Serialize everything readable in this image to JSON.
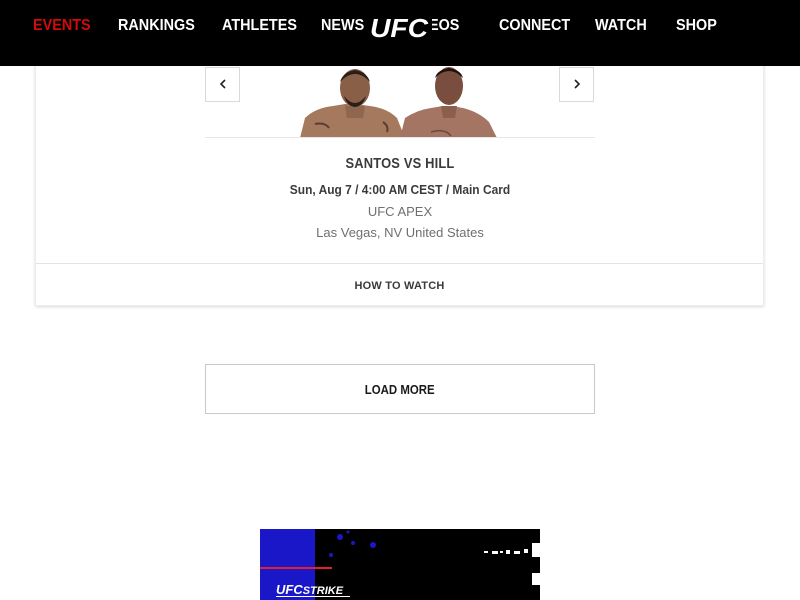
{
  "nav": {
    "items": [
      {
        "label": "EVENTS",
        "active": true
      },
      {
        "label": "RANKINGS",
        "active": false
      },
      {
        "label": "ATHLETES",
        "active": false
      },
      {
        "label": "NEWS",
        "active": false
      },
      {
        "label": "VIDEOS",
        "active": false
      },
      {
        "label": "CONNECT",
        "active": false
      },
      {
        "label": "WATCH",
        "active": false
      },
      {
        "label": "SHOP",
        "active": false
      }
    ],
    "logo_text": "UFC",
    "active_color": "#d20a0a"
  },
  "event": {
    "title": "SANTOS VS HILL",
    "datetime": "Sun, Aug 7 / 4:00 AM CEST / Main Card",
    "venue": "UFC APEX",
    "location": "Las Vegas, NV United States",
    "how_to_watch": "HOW TO WATCH",
    "prev_icon": "chevron-left-icon",
    "next_icon": "chevron-right-icon"
  },
  "load_more_label": "LOAD MORE",
  "ad": {
    "brand": "UFC",
    "brand_suffix": "STRIKE",
    "colors": {
      "blue": "#1a17c9",
      "red": "#e0202a"
    }
  }
}
